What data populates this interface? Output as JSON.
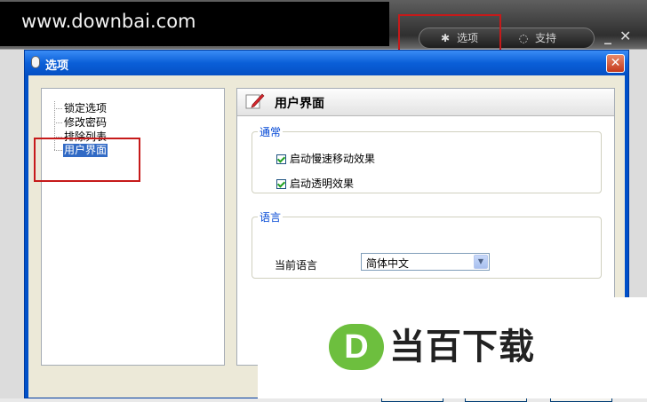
{
  "watermark_site": "www.downbai.com",
  "top_bar": {
    "options_label": "选项",
    "support_label": "支持",
    "minimize": "_",
    "close": "✕"
  },
  "dialog": {
    "title": "选项",
    "close_glyph": "✕"
  },
  "tree": {
    "items": [
      {
        "label": "锁定选项",
        "selected": false
      },
      {
        "label": "修改密码",
        "selected": false
      },
      {
        "label": "排除列表",
        "selected": false
      },
      {
        "label": "用户界面",
        "selected": true
      }
    ]
  },
  "panel": {
    "title": "用户界面",
    "general_group": {
      "legend": "通常",
      "options": [
        {
          "label": "启动慢速移动效果",
          "checked": true
        },
        {
          "label": "启动透明效果",
          "checked": true
        }
      ]
    },
    "language_group": {
      "legend": "语言",
      "label": "当前语言",
      "selected": "简体中文"
    }
  },
  "logo": {
    "mark": "D",
    "text": "当百下载"
  },
  "colors": {
    "title_bar": "#0a5fd8",
    "selection": "#316ac5",
    "legend": "#0046d5",
    "highlight_box": "#c61a1a",
    "logo_green": "#6dbf3e"
  }
}
